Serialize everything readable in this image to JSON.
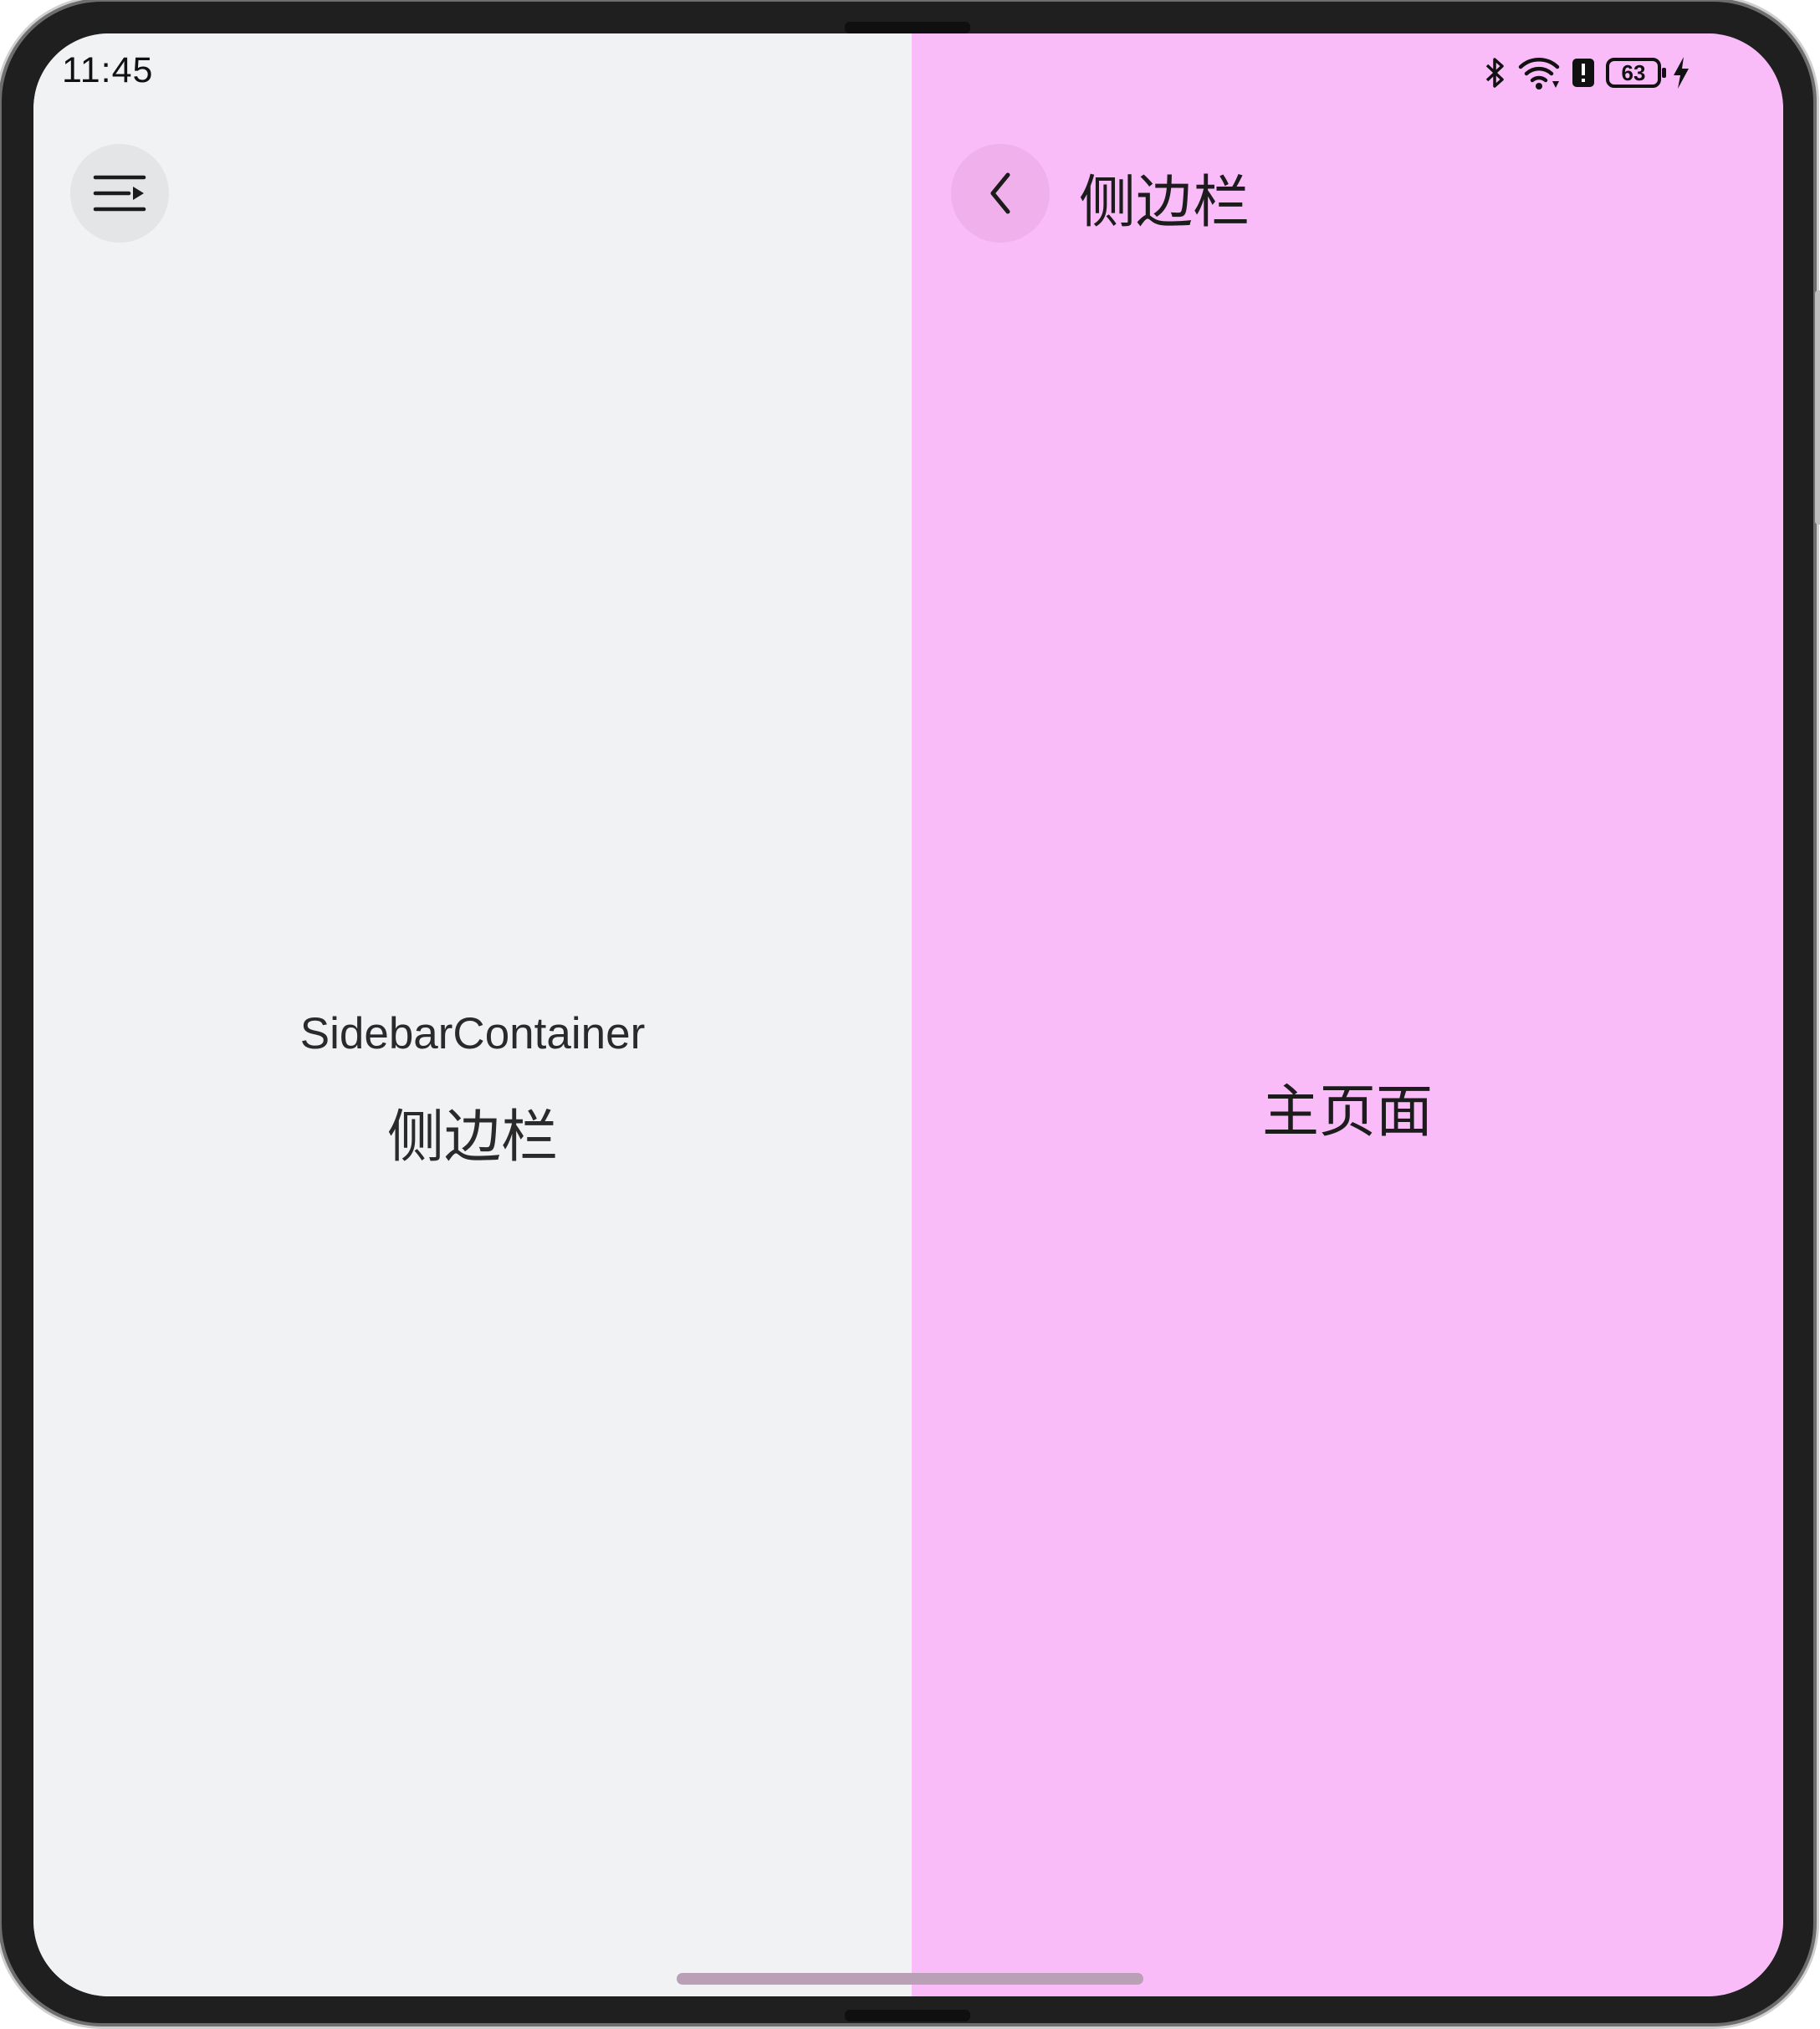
{
  "status_bar": {
    "time": "11:45",
    "icons": [
      "bluetooth-icon",
      "wifi-icon",
      "alert-icon",
      "battery-icon",
      "charging-icon"
    ],
    "battery_level": "63"
  },
  "sidebar": {
    "toggle_icon": "sidebar-toggle-icon",
    "container_label": "SidebarContainer",
    "label": "侧边栏",
    "background": "#f1f2f4"
  },
  "main": {
    "back_icon": "chevron-left-icon",
    "title": "侧边栏",
    "content": "主页面",
    "background": "#f9bcf8"
  }
}
